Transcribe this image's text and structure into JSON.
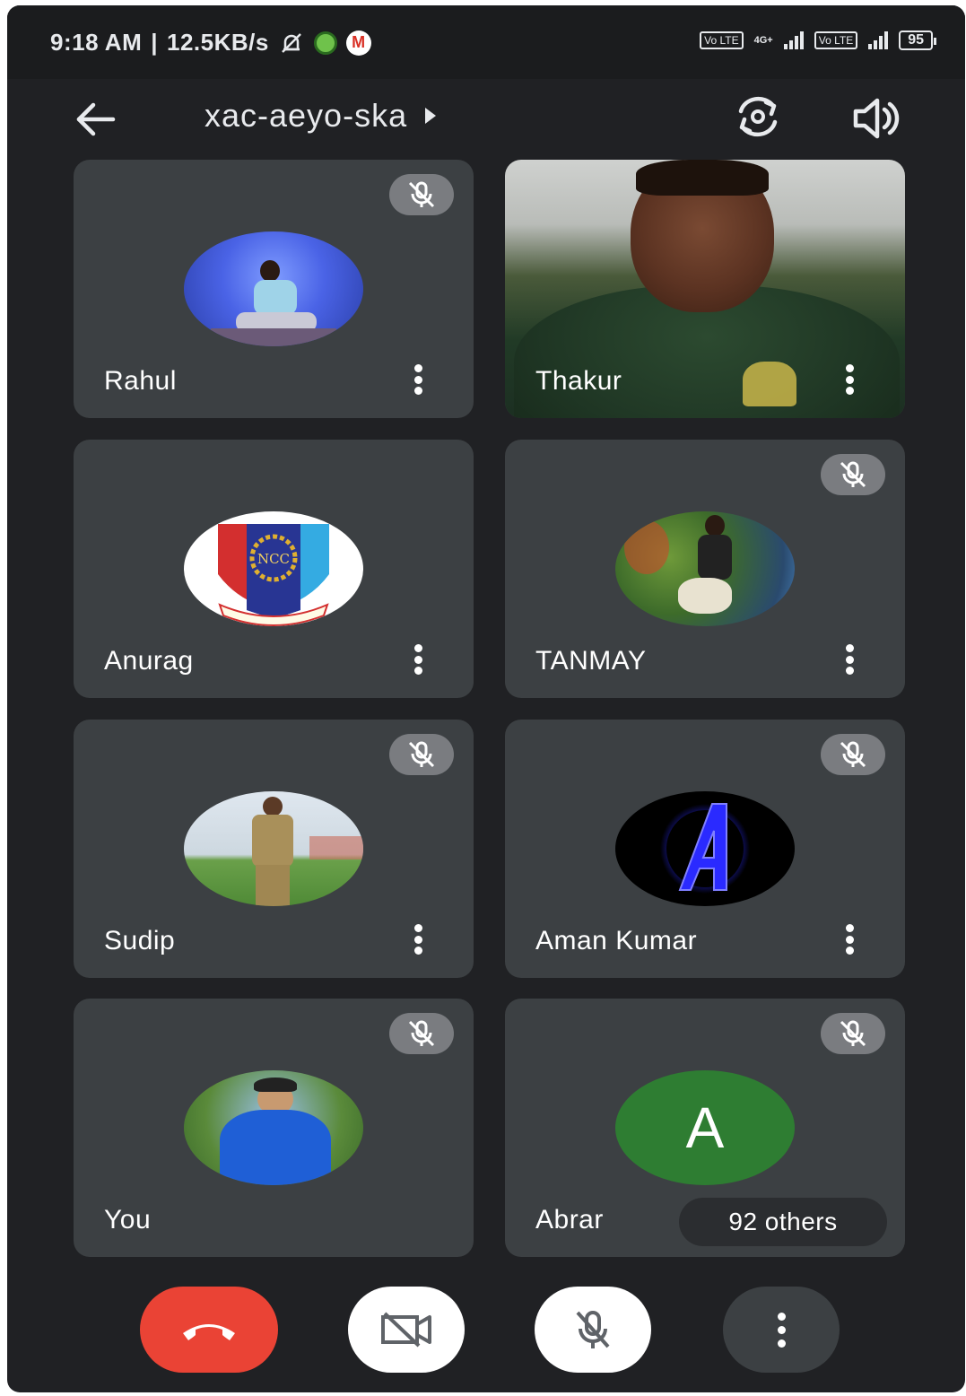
{
  "status_bar": {
    "time": "9:18 AM",
    "separator": "|",
    "speed": "12.5KB/s",
    "sim1_label": "Vo LTE",
    "network_type": "4G+",
    "sim2_label": "Vo LTE",
    "battery": "95"
  },
  "header": {
    "meeting_code": "xac-aeyo-ska"
  },
  "tiles": [
    {
      "name": "Rahul",
      "muted": true,
      "avatar": "photo"
    },
    {
      "name": "Thakur",
      "muted": false,
      "avatar": "video"
    },
    {
      "name": "Anurag",
      "muted": false,
      "avatar": "ncc-logo"
    },
    {
      "name": "TANMAY",
      "muted": true,
      "avatar": "photo"
    },
    {
      "name": "Sudip",
      "muted": true,
      "avatar": "photo"
    },
    {
      "name": "Aman Kumar",
      "muted": true,
      "avatar": "avengers-logo"
    },
    {
      "name": "You",
      "muted": true,
      "avatar": "photo"
    },
    {
      "name": "Abrar",
      "muted": true,
      "avatar": "initial",
      "initial": "A"
    }
  ],
  "others_chip": "92 others",
  "ncc_text": "NCC",
  "colors": {
    "background": "#202124",
    "tile": "#3c4043",
    "end_call": "#ea4335",
    "abrar_avatar": "#2e7d32"
  }
}
